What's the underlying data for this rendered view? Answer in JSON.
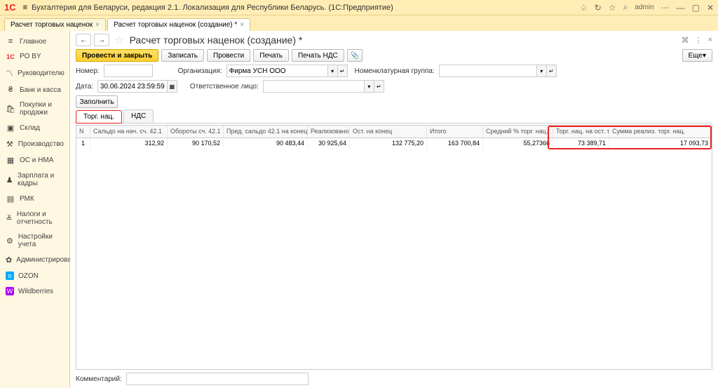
{
  "title": "Бухгалтерия для Беларуси, редакция 2.1. Локализация для Республики Беларусь.  (1С:Предприятие)",
  "user": "admin",
  "tabs": [
    {
      "label": "Расчет торговых наценок"
    },
    {
      "label": "Расчет торговых наценок (создание) *"
    }
  ],
  "sidebar": [
    {
      "icon": "≡",
      "label": "Главное"
    },
    {
      "icon": "1С",
      "label": "PO BY",
      "color": "#e22"
    },
    {
      "icon": "📈",
      "label": "Руководителю"
    },
    {
      "icon": "🏦",
      "label": "Банк и касса"
    },
    {
      "icon": "🛒",
      "label": "Покупки и продажи"
    },
    {
      "icon": "📦",
      "label": "Склад"
    },
    {
      "icon": "🏭",
      "label": "Производство"
    },
    {
      "icon": "🚚",
      "label": "ОС и НМА"
    },
    {
      "icon": "👥",
      "label": "Зарплата и кадры"
    },
    {
      "icon": "📱",
      "label": "РМК"
    },
    {
      "icon": "📊",
      "label": "Налоги и отчетность"
    },
    {
      "icon": "⚙",
      "label": "Настройки учета"
    },
    {
      "icon": "🔧",
      "label": "Администрирование"
    },
    {
      "icon": "O",
      "label": "OZON",
      "color": "#0af"
    },
    {
      "icon": "W",
      "label": "Wildberries",
      "color": "#a0f"
    }
  ],
  "page": {
    "title": "Расчет торговых наценок (создание) *",
    "buttons": {
      "post_close": "Провести и закрыть",
      "write": "Записать",
      "post": "Провести",
      "print": "Печать",
      "print_vat": "Печать НДС",
      "more": "Еще"
    },
    "fields": {
      "number_label": "Номер:",
      "number": "",
      "org_label": "Организация:",
      "org": "Фирма УСН ООО",
      "nomgroup_label": "Номенклатурная группа:",
      "nomgroup": "",
      "date_label": "Дата:",
      "date": "30.06.2024 23:59:59",
      "resp_label": "Ответственное лицо:",
      "resp": "",
      "fill": "Заполнить"
    },
    "subtabs": [
      "Торг. нац.",
      "НДС"
    ],
    "columns": [
      "N",
      "Сальдо на нач. сч. 42.1",
      "Обороты сч. 42.1",
      "Пред. сальдо 42.1 на конец.",
      "Реализовано",
      "Ост. на конец",
      "Итого",
      "Средний % торг. нац.",
      "Торг. нац. на ост. тов.",
      "Сумма реализ. торг. нац."
    ],
    "row": {
      "n": "1",
      "saldo_start": "312,92",
      "oborot": "90 170,52",
      "pred_saldo": "90 483,44",
      "realized": "30 925,64",
      "ost_end": "132 775,20",
      "itogo": "163 700,84",
      "avg_pct": "55,27366",
      "nac_ost": "73 389,71",
      "sum_real": "17 093,73"
    },
    "comment_label": "Комментарий:"
  }
}
